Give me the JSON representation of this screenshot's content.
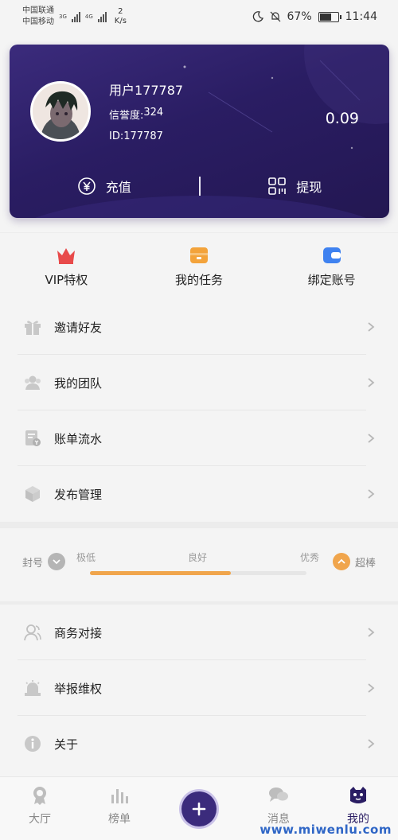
{
  "status_bar": {
    "carrier_1": "中国联通",
    "carrier_2": "中国移动",
    "net_1": "3G",
    "net_2": "4G",
    "speed_value": "2",
    "speed_unit": "K/s",
    "battery": "67%",
    "time": "11:44"
  },
  "profile": {
    "username": "用户177787",
    "credit_label": "信誉度:",
    "credit_value": "324",
    "id_label": "ID:",
    "id_value": "177787",
    "balance": "0.09",
    "recharge_label": "充值",
    "withdraw_label": "提现"
  },
  "quick_menu": [
    {
      "label": "VIP特权",
      "icon": "crown-icon",
      "color": "#e84a4a"
    },
    {
      "label": "我的任务",
      "icon": "task-box-icon",
      "color": "#f3a33b"
    },
    {
      "label": "绑定账号",
      "icon": "wallet-icon",
      "color": "#3f82f0"
    }
  ],
  "menu_group_1": [
    {
      "label": "邀请好友",
      "icon": "gift-icon"
    },
    {
      "label": "我的团队",
      "icon": "team-icon"
    },
    {
      "label": "账单流水",
      "icon": "bill-icon"
    },
    {
      "label": "发布管理",
      "icon": "package-icon"
    }
  ],
  "rating": {
    "left_label": "封号",
    "right_label": "超棒",
    "ticks": [
      "极低",
      "良好",
      "优秀"
    ],
    "progress": 0.65,
    "progress_color": "#f0a54c"
  },
  "menu_group_2": [
    {
      "label": "商务对接",
      "icon": "contact-icon"
    },
    {
      "label": "举报维权",
      "icon": "alarm-icon"
    },
    {
      "label": "关于",
      "icon": "info-icon"
    }
  ],
  "bottom_nav": [
    {
      "label": "大厅",
      "icon": "badge-icon"
    },
    {
      "label": "榜单",
      "icon": "chart-icon"
    },
    {
      "label": "",
      "icon": "plus-icon"
    },
    {
      "label": "消息",
      "icon": "chat-icon"
    },
    {
      "label": "我的",
      "icon": "mascot-icon"
    }
  ],
  "watermark": "www.miwenlu.com",
  "colors": {
    "card_bg": "#2a1d63",
    "accent": "#3b2b7c"
  }
}
